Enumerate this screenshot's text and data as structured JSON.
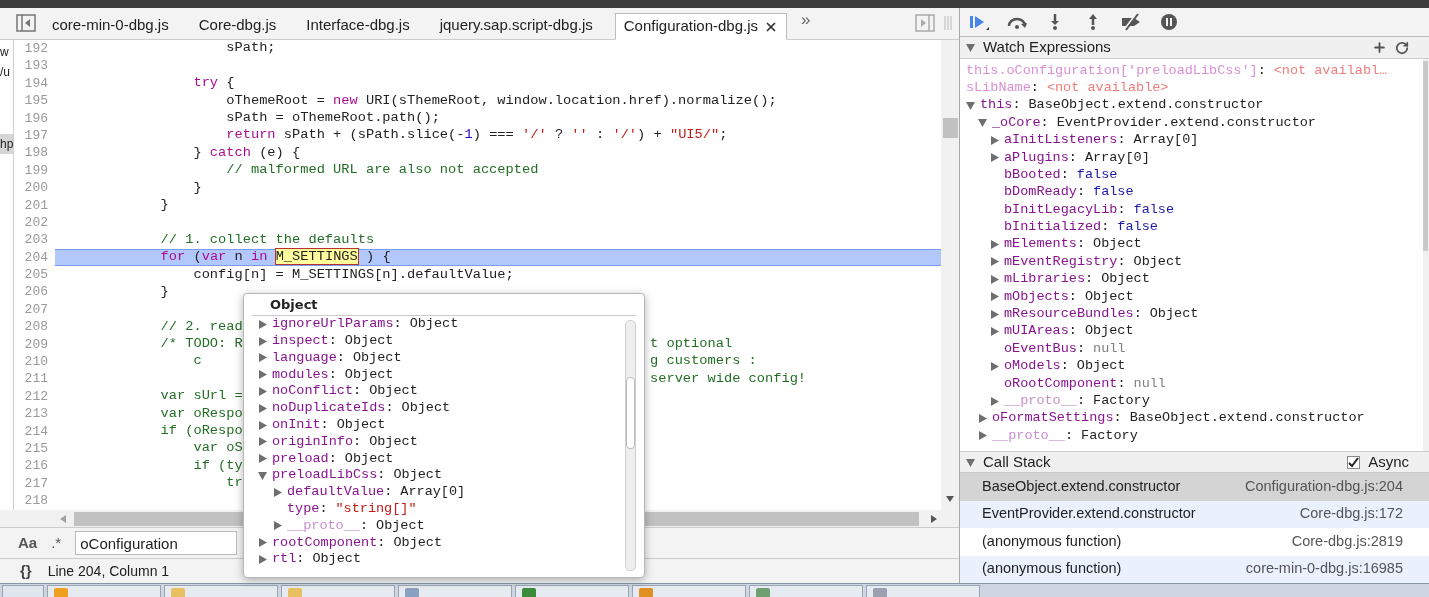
{
  "left_fragments": [
    {
      "text": "w",
      "selected": false
    },
    {
      "text": "/u",
      "selected": false
    },
    {
      "text": "hp",
      "selected": true
    }
  ],
  "tabs": [
    {
      "label": "core-min-0-dbg.js",
      "selected": false
    },
    {
      "label": "Core-dbg.js",
      "selected": false
    },
    {
      "label": "Interface-dbg.js",
      "selected": false
    },
    {
      "label": "jquery.sap.script-dbg.js",
      "selected": false
    },
    {
      "label": "Configuration-dbg.js",
      "selected": true
    }
  ],
  "tab_overflow": "»",
  "code_lines": [
    {
      "number": "192",
      "current": false,
      "tokens": [
        {
          "kind": "plain",
          "text": "                    sPath;"
        }
      ]
    },
    {
      "number": "193",
      "current": false
    },
    {
      "number": "194",
      "current": false,
      "tokens": [
        {
          "kind": "keyword",
          "text": "                try"
        },
        {
          "kind": "plain",
          "text": " {"
        }
      ]
    },
    {
      "number": "195",
      "current": false,
      "tokens": [
        {
          "kind": "plain",
          "text": "                    oThemeRoot = "
        },
        {
          "kind": "keyword",
          "text": "new"
        },
        {
          "kind": "plain",
          "text": " URI(sThemeRoot, window.location.href).normalize();"
        }
      ]
    },
    {
      "number": "196",
      "current": false,
      "tokens": [
        {
          "kind": "plain",
          "text": "                    sPath = oThemeRoot.path();"
        }
      ]
    },
    {
      "number": "197",
      "current": false,
      "tokens": [
        {
          "kind": "keyword",
          "text": "                    return"
        },
        {
          "kind": "plain",
          "text": " sPath + (sPath.slice(-"
        },
        {
          "kind": "number",
          "text": "1"
        },
        {
          "kind": "plain",
          "text": ") === "
        },
        {
          "kind": "string",
          "text": "'/'"
        },
        {
          "kind": "plain",
          "text": " ? "
        },
        {
          "kind": "string",
          "text": "''"
        },
        {
          "kind": "plain",
          "text": " : "
        },
        {
          "kind": "string",
          "text": "'/'"
        },
        {
          "kind": "plain",
          "text": ") + "
        },
        {
          "kind": "string",
          "text": "\"UI5/\""
        },
        {
          "kind": "plain",
          "text": ";"
        }
      ]
    },
    {
      "number": "198",
      "current": false,
      "tokens": [
        {
          "kind": "plain",
          "text": "                } "
        },
        {
          "kind": "keyword",
          "text": "catch"
        },
        {
          "kind": "plain",
          "text": " (e) {"
        }
      ]
    },
    {
      "number": "199",
      "current": false,
      "tokens": [
        {
          "kind": "comment",
          "text": "                    // malformed URL are also not accepted"
        }
      ]
    },
    {
      "number": "200",
      "current": false,
      "tokens": [
        {
          "kind": "plain",
          "text": "                }"
        }
      ]
    },
    {
      "number": "201",
      "current": false,
      "tokens": [
        {
          "kind": "plain",
          "text": "            }"
        }
      ]
    },
    {
      "number": "202",
      "current": false
    },
    {
      "number": "203",
      "current": false,
      "tokens": [
        {
          "kind": "comment",
          "text": "            // 1. collect the defaults"
        }
      ]
    },
    {
      "number": "204",
      "current": true,
      "tokens": [
        {
          "kind": "keyword",
          "text": "            for"
        },
        {
          "kind": "plain",
          "text": " ("
        },
        {
          "kind": "keyword",
          "text": "var"
        },
        {
          "kind": "plain",
          "text": " n "
        },
        {
          "kind": "keyword",
          "text": "in "
        },
        {
          "kind": "match",
          "text": "M_SETTINGS"
        },
        {
          "kind": "plain",
          "text": " ) {"
        }
      ]
    },
    {
      "number": "205",
      "current": false,
      "tokens": [
        {
          "kind": "plain",
          "text": "                config[n] = M_SETTINGS[n].defaultValue;"
        }
      ]
    },
    {
      "number": "206",
      "current": false,
      "tokens": [
        {
          "kind": "plain",
          "text": "            }"
        }
      ]
    },
    {
      "number": "207",
      "current": false
    },
    {
      "number": "208",
      "current": false,
      "tokens": [
        {
          "kind": "comment",
          "text": "            // 2. read"
        }
      ]
    },
    {
      "number": "209",
      "current": false,
      "tokens": [
        {
          "kind": "comment",
          "text": "            /* TODO: R"
        }
      ],
      "right_tokens": [
        {
          "kind": "comment",
          "text": "t optional"
        }
      ]
    },
    {
      "number": "210",
      "current": false,
      "tokens": [
        {
          "kind": "comment",
          "text": "                c"
        }
      ],
      "right_tokens": [
        {
          "kind": "comment",
          "text": "g customers :"
        }
      ]
    },
    {
      "number": "211",
      "current": false,
      "right_tokens": [
        {
          "kind": "comment",
          "text": "server wide config!"
        }
      ]
    },
    {
      "number": "212",
      "current": false,
      "tokens": [
        {
          "kind": "comment",
          "text": "            var sUrl ="
        }
      ]
    },
    {
      "number": "213",
      "current": false,
      "tokens": [
        {
          "kind": "comment",
          "text": "            var oRespo"
        }
      ]
    },
    {
      "number": "214",
      "current": false,
      "tokens": [
        {
          "kind": "comment",
          "text": "            if (oRespo"
        }
      ]
    },
    {
      "number": "215",
      "current": false,
      "tokens": [
        {
          "kind": "comment",
          "text": "                var oS"
        }
      ]
    },
    {
      "number": "216",
      "current": false,
      "tokens": [
        {
          "kind": "comment",
          "text": "                if (ty"
        }
      ]
    },
    {
      "number": "217",
      "current": false,
      "tokens": [
        {
          "kind": "comment",
          "text": "                    tr"
        }
      ]
    },
    {
      "number": "218",
      "current": false
    }
  ],
  "popup": {
    "title": "Object",
    "items": [
      {
        "kind": "branch",
        "expanded": false,
        "name": "ignoreUrlParams:",
        "value": {
          "kind": "object",
          "text": "Object"
        }
      },
      {
        "kind": "branch",
        "expanded": false,
        "name": "inspect:",
        "value": {
          "kind": "object",
          "text": "Object"
        }
      },
      {
        "kind": "branch",
        "expanded": false,
        "name": "language:",
        "value": {
          "kind": "object",
          "text": "Object"
        }
      },
      {
        "kind": "branch",
        "expanded": false,
        "name": "modules:",
        "value": {
          "kind": "object",
          "text": "Object"
        }
      },
      {
        "kind": "branch",
        "expanded": false,
        "name": "noConflict:",
        "value": {
          "kind": "object",
          "text": "Object"
        }
      },
      {
        "kind": "branch",
        "expanded": false,
        "name": "noDuplicateIds:",
        "value": {
          "kind": "object",
          "text": "Object"
        }
      },
      {
        "kind": "branch",
        "expanded": false,
        "name": "onInit:",
        "value": {
          "kind": "object",
          "text": "Object"
        }
      },
      {
        "kind": "branch",
        "expanded": false,
        "name": "originInfo:",
        "value": {
          "kind": "object",
          "text": "Object"
        }
      },
      {
        "kind": "branch",
        "expanded": false,
        "name": "preload:",
        "value": {
          "kind": "object",
          "text": "Object"
        }
      },
      {
        "kind": "branch",
        "expanded": true,
        "name": "preloadLibCss:",
        "value": {
          "kind": "object",
          "text": "Object"
        },
        "children": [
          {
            "kind": "branch",
            "expanded": false,
            "name": "defaultValue:",
            "value": {
              "kind": "object",
              "text": "Array[0]"
            }
          },
          {
            "kind": "leaf",
            "name": "type:",
            "value": {
              "kind": "string",
              "text": "\"string[]\""
            }
          },
          {
            "kind": "internal",
            "expanded": false,
            "name": "__proto__:",
            "value": {
              "kind": "object",
              "text": "Object"
            }
          }
        ]
      },
      {
        "kind": "branch",
        "expanded": false,
        "name": "rootComponent:",
        "value": {
          "kind": "object",
          "text": "Object"
        }
      },
      {
        "kind": "branch",
        "expanded": false,
        "name": "rtl:",
        "value": {
          "kind": "object",
          "text": "Object"
        }
      }
    ]
  },
  "search": {
    "case_label": "Aa",
    "regex_label": ".*",
    "value": "oConfiguration"
  },
  "status": {
    "format_label": "{}",
    "position": "Line 204, Column 1"
  },
  "watch": {
    "title": "Watch Expressions",
    "expanded": true,
    "items": [
      {
        "kind": "expression",
        "name": "this.oConfiguration['preloadLibCss']:",
        "value": {
          "kind": "unavailable",
          "text": "<not availabl…"
        }
      },
      {
        "kind": "expression",
        "name": "sLibName:",
        "value": {
          "kind": "unavailable",
          "text": "<not available>"
        }
      },
      {
        "kind": "branch",
        "expanded": true,
        "name": "this:",
        "value": {
          "kind": "object",
          "text": "BaseObject.extend.constructor"
        },
        "children": [
          {
            "kind": "branch",
            "expanded": true,
            "name": "_oCore:",
            "value": {
              "kind": "object",
              "text": "EventProvider.extend.constructor"
            },
            "children": [
              {
                "kind": "branch",
                "expanded": false,
                "name": "aInitListeners:",
                "value": {
                  "kind": "object",
                  "text": "Array[0]"
                }
              },
              {
                "kind": "branch",
                "expanded": false,
                "name": "aPlugins:",
                "value": {
                  "kind": "object",
                  "text": "Array[0]"
                }
              },
              {
                "kind": "leaf",
                "name": "bBooted:",
                "value": {
                  "kind": "boolean",
                  "text": "false"
                }
              },
              {
                "kind": "leaf",
                "name": "bDomReady:",
                "value": {
                  "kind": "boolean",
                  "text": "false"
                }
              },
              {
                "kind": "leaf",
                "name": "bInitLegacyLib:",
                "value": {
                  "kind": "boolean",
                  "text": "false"
                }
              },
              {
                "kind": "leaf",
                "name": "bInitialized:",
                "value": {
                  "kind": "boolean",
                  "text": "false"
                }
              },
              {
                "kind": "branch",
                "expanded": false,
                "name": "mElements:",
                "value": {
                  "kind": "object",
                  "text": "Object"
                }
              },
              {
                "kind": "branch",
                "expanded": false,
                "name": "mEventRegistry:",
                "value": {
                  "kind": "object",
                  "text": "Object"
                }
              },
              {
                "kind": "branch",
                "expanded": false,
                "name": "mLibraries:",
                "value": {
                  "kind": "object",
                  "text": "Object"
                }
              },
              {
                "kind": "branch",
                "expanded": false,
                "name": "mObjects:",
                "value": {
                  "kind": "object",
                  "text": "Object"
                }
              },
              {
                "kind": "branch",
                "expanded": false,
                "name": "mResourceBundles:",
                "value": {
                  "kind": "object",
                  "text": "Object"
                }
              },
              {
                "kind": "branch",
                "expanded": false,
                "name": "mUIAreas:",
                "value": {
                  "kind": "object",
                  "text": "Object"
                }
              },
              {
                "kind": "leaf",
                "name": "oEventBus:",
                "value": {
                  "kind": "null",
                  "text": "null"
                }
              },
              {
                "kind": "branch",
                "expanded": false,
                "name": "oModels:",
                "value": {
                  "kind": "object",
                  "text": "Object"
                }
              },
              {
                "kind": "leaf",
                "name": "oRootComponent:",
                "value": {
                  "kind": "null",
                  "text": "null"
                }
              },
              {
                "kind": "internal",
                "expanded": false,
                "name": "__proto__:",
                "value": {
                  "kind": "object",
                  "text": "Factory"
                }
              }
            ]
          },
          {
            "kind": "branch",
            "expanded": false,
            "name": "oFormatSettings:",
            "value": {
              "kind": "object",
              "text": "BaseObject.extend.constructor"
            }
          },
          {
            "kind": "internal",
            "expanded": false,
            "name": "__proto__:",
            "value": {
              "kind": "object",
              "text": "Factory"
            }
          }
        ]
      }
    ]
  },
  "call_stack": {
    "title": "Call Stack",
    "expanded": true,
    "async_label": "Async",
    "async_checked": true,
    "frames": [
      {
        "function": "BaseObject.extend.constructor",
        "location": "Configuration-dbg.js:204",
        "selected": true
      },
      {
        "function": "EventProvider.extend.constructor",
        "location": "Core-dbg.js:172",
        "selected": false
      },
      {
        "function": "(anonymous function)",
        "location": "Core-dbg.js:2819",
        "selected": false
      },
      {
        "function": "(anonymous function)",
        "location": "core-min-0-dbg.js:16985",
        "selected": false
      }
    ]
  }
}
